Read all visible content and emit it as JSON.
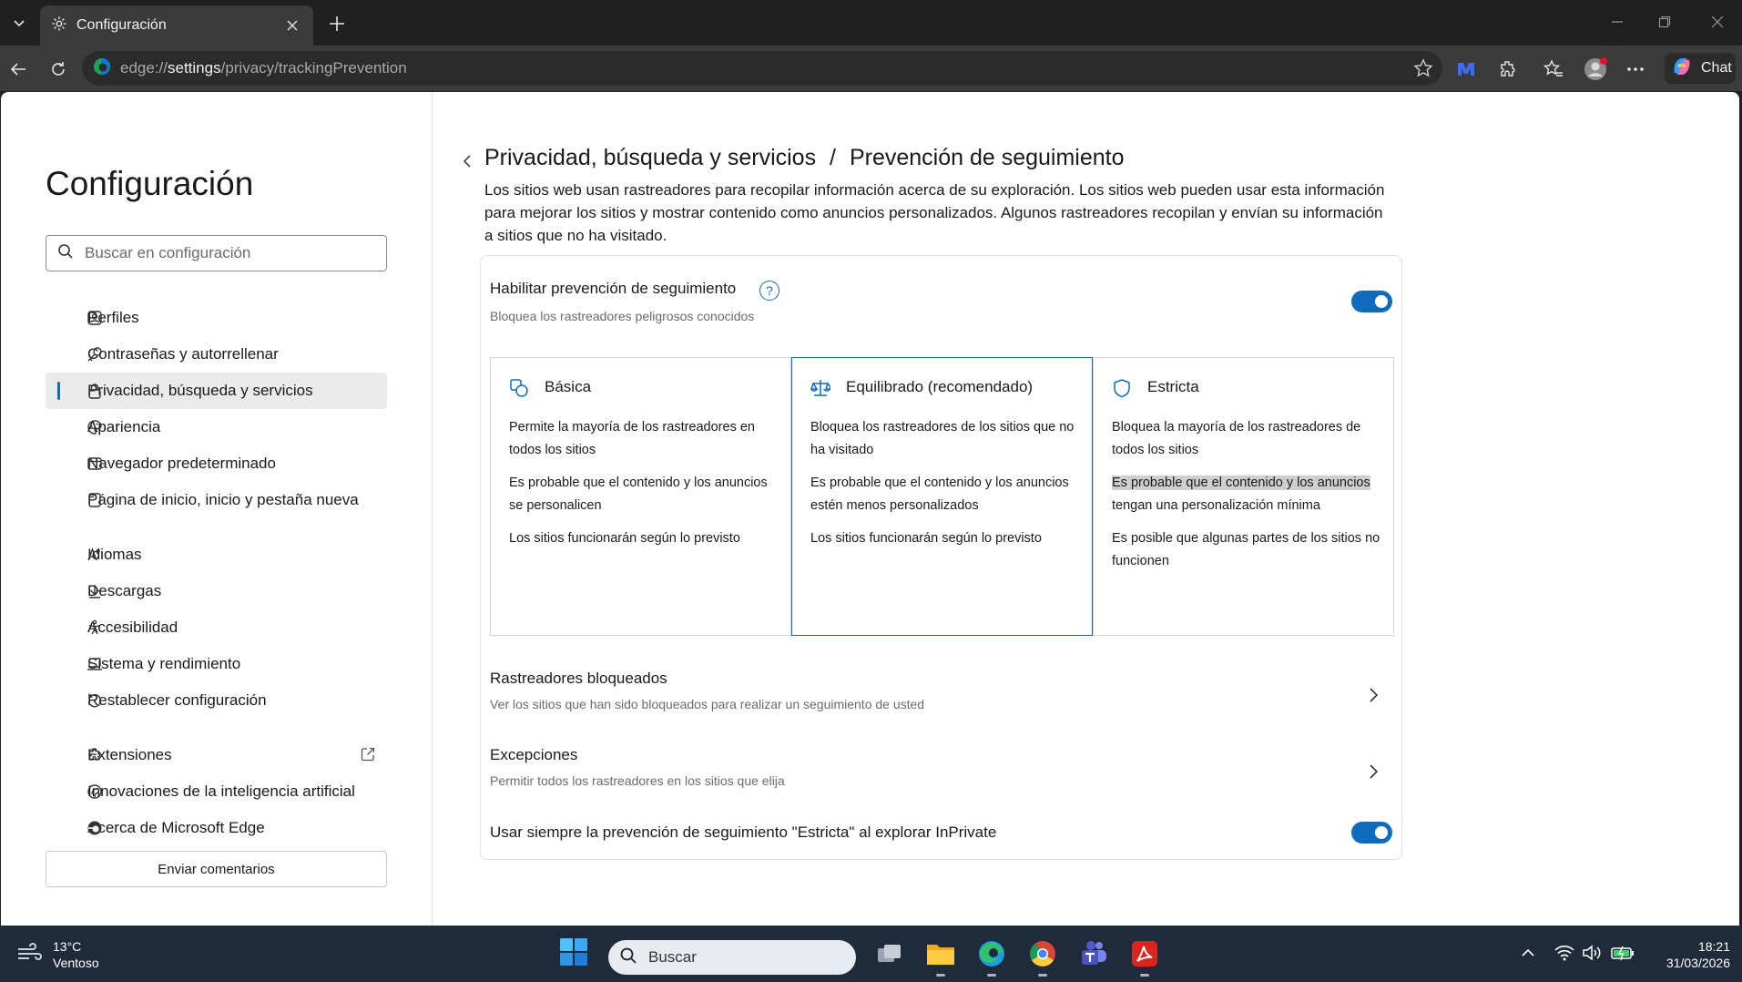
{
  "browser": {
    "tab_title": "Configuración",
    "url_scheme": "edge://",
    "url_host": "settings",
    "url_path": "/privacy/trackingPrevention",
    "chat_label": "Chat"
  },
  "sidebar": {
    "title": "Configuración",
    "search_placeholder": "Buscar en configuración",
    "items": [
      {
        "label": "Perfiles",
        "icon": "profile-icon"
      },
      {
        "label": "Contraseñas y autorrellenar",
        "icon": "key-icon"
      },
      {
        "label": "Privacidad, búsqueda y servicios",
        "icon": "lock-icon",
        "active": true
      },
      {
        "label": "Apariencia",
        "icon": "palette-icon"
      },
      {
        "label": "Navegador predeterminado",
        "icon": "browser-icon"
      },
      {
        "label": "Página de inicio, inicio y pestaña nueva",
        "icon": "home-tab-icon"
      },
      {
        "label": "Idiomas",
        "icon": "language-icon"
      },
      {
        "label": "Descargas",
        "icon": "download-icon"
      },
      {
        "label": "Accesibilidad",
        "icon": "accessibility-icon"
      },
      {
        "label": "Sistema y rendimiento",
        "icon": "laptop-icon"
      },
      {
        "label": "Restablecer configuración",
        "icon": "reset-icon"
      },
      {
        "label": "Extensiones",
        "icon": "puzzle-icon"
      },
      {
        "label": "Innovaciones de la inteligencia artificial",
        "icon": "ai-icon"
      },
      {
        "label": "Acerca de Microsoft Edge",
        "icon": "edge-icon"
      }
    ],
    "feedback_label": "Enviar comentarios"
  },
  "main": {
    "breadcrumb_parent": "Privacidad, búsqueda y servicios",
    "breadcrumb_sep": "/",
    "breadcrumb_current": "Prevención de seguimiento",
    "description": "Los sitios web usan rastreadores para recopilar información acerca de su exploración. Los sitios web pueden usar esta información para mejorar los sitios y mostrar contenido como anuncios personalizados. Algunos rastreadores recopilan y envían su información a sitios que no ha visitado.",
    "enable": {
      "label": "Habilitar prevención de seguimiento",
      "sub": "Bloquea los rastreadores peligrosos conocidos",
      "help": "?",
      "on": true
    },
    "levels": [
      {
        "title": "Básica",
        "p1": "Permite la mayoría de los rastreadores en todos los sitios",
        "p2": "Es probable que el contenido y los anuncios se personalicen",
        "p3": "Los sitios funcionarán según lo previsto"
      },
      {
        "title": "Equilibrado (recomendado)",
        "selected": true,
        "p1": "Bloquea los rastreadores de los sitios que no ha visitado",
        "p2": "Es probable que el contenido y los anuncios estén menos personalizados",
        "p3": "Los sitios funcionarán según lo previsto"
      },
      {
        "title": "Estricta",
        "p1": "Bloquea la mayoría de los rastreadores de todos los sitios",
        "p2_highlight": "Es probable que el contenido y los anuncios",
        "p2_rest": "tengan una personalización mínima",
        "p3": "Es posible que algunas partes de los sitios no funcionen"
      }
    ],
    "blocked": {
      "label": "Rastreadores bloqueados",
      "sub": "Ver los sitios que han sido bloqueados para realizar un seguimiento de usted"
    },
    "exceptions": {
      "label": "Excepciones",
      "sub": "Permitir todos los rastreadores en los sitios que elija"
    },
    "inprivate": {
      "label": "Usar siempre la prevención de seguimiento \"Estricta\" al explorar InPrivate",
      "on": true
    }
  },
  "taskbar": {
    "temperature": "13°C",
    "condition": "Ventoso",
    "search_label": "Buscar",
    "time": "18:21",
    "date": "31/03/2026"
  },
  "colors": {
    "accent": "#0f6cbd",
    "taskbar": "#1f2b3a",
    "chrome": "#3b3b3b"
  }
}
